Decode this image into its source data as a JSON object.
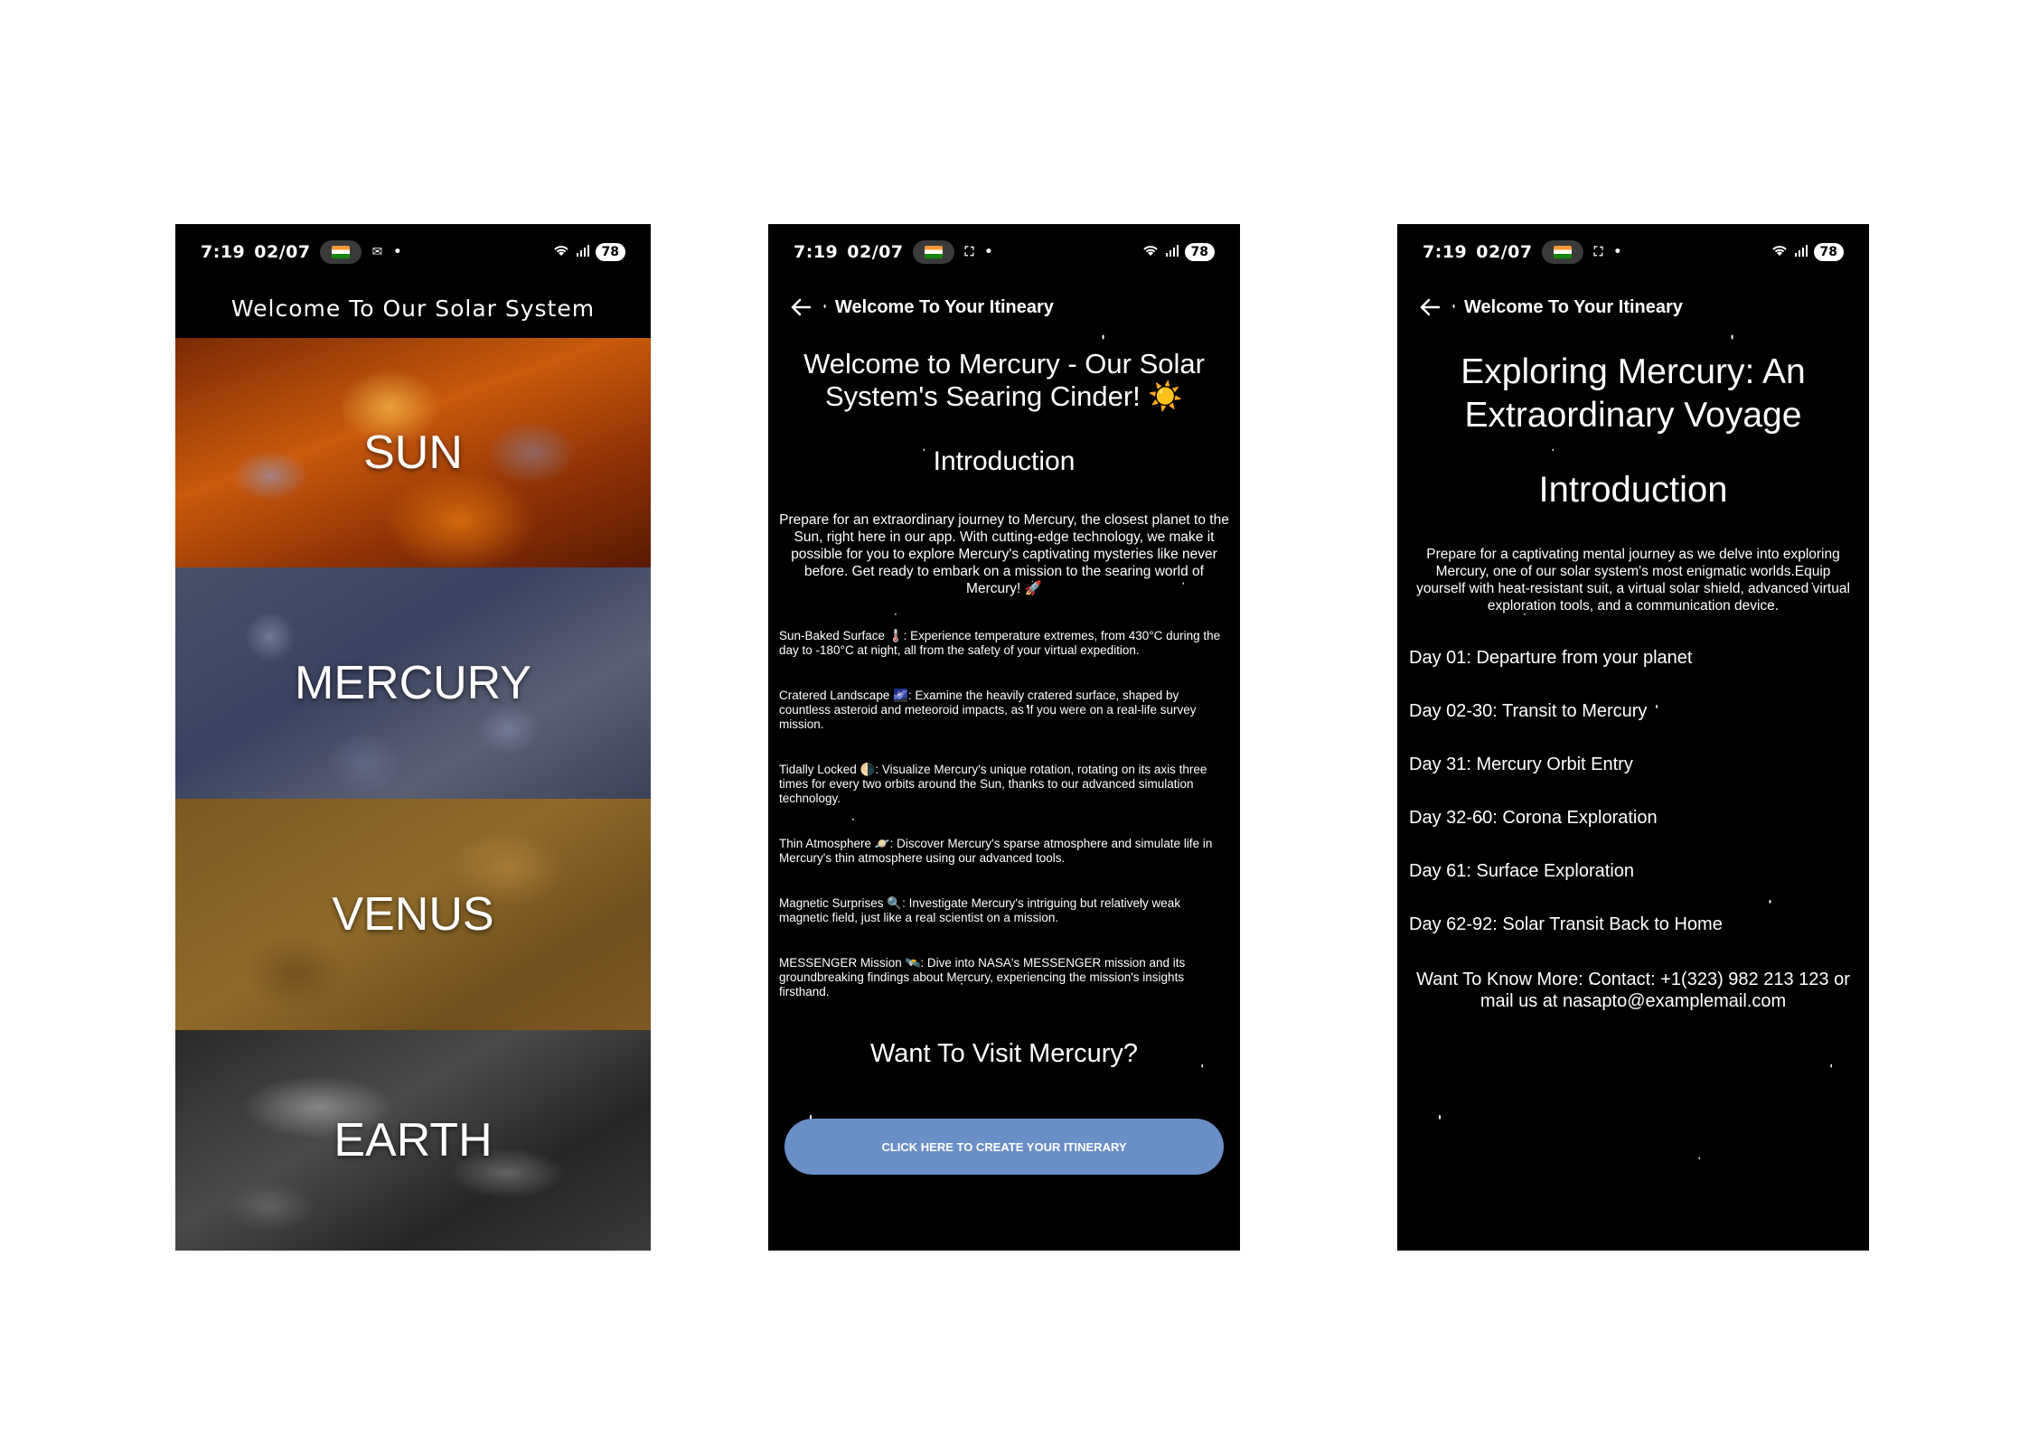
{
  "status_bar": {
    "time": "7:19",
    "date": "02/07",
    "battery": "78"
  },
  "screen1": {
    "title": "Welcome To Our Solar System",
    "planets": [
      "SUN",
      "MERCURY",
      "VENUS",
      "EARTH"
    ]
  },
  "screen2": {
    "appbar_title": "Welcome To Your Itineary",
    "heading": "Welcome to Mercury - Our Solar System's Searing Cinder! ☀️",
    "intro_heading": "Introduction",
    "intro_text": "Prepare for an extraordinary journey to Mercury, the closest planet to the Sun, right here in our app. With cutting-edge technology, we make it possible for you to explore Mercury's captivating mysteries like never before. Get ready to embark on a mission to the searing world of Mercury! 🚀",
    "features": [
      "Sun-Baked Surface 🌡️: Experience temperature extremes, from 430°C during the day to -180°C at night, all from the safety of your virtual expedition.",
      "Cratered Landscape 🌌: Examine the heavily cratered surface, shaped by countless asteroid and meteoroid impacts, as if you were on a real-life survey mission.",
      "Tidally Locked 🌗: Visualize Mercury's unique rotation, rotating on its axis three times for every two orbits around the Sun, thanks to our advanced simulation technology.",
      "Thin Atmosphere 🪐: Discover Mercury's sparse atmosphere and simulate life in Mercury's thin atmosphere using our advanced tools.",
      "Magnetic Surprises 🔍: Investigate Mercury's intriguing but relatively weak magnetic field, just like a real scientist on a mission.",
      "MESSENGER Mission 🛰️: Dive into NASA's MESSENGER mission and its groundbreaking findings about Mercury, experiencing the mission's insights firsthand."
    ],
    "visit_heading": "Want To Visit Mercury?",
    "cta_label": "CLICK HERE TO CREATE YOUR ITINERARY"
  },
  "screen3": {
    "appbar_title": "Welcome To Your Itineary",
    "heading": "Exploring Mercury: An Extraordinary Voyage",
    "intro_heading": "Introduction",
    "intro_text": "Prepare for a captivating mental journey as we delve into exploring Mercury, one of our solar system's most enigmatic worlds.Equip yourself with heat-resistant suit, a virtual solar shield, advanced virtual exploration tools, and a communication device.",
    "days": [
      "Day 01: Departure from your planet",
      "Day 02-30: Transit to Mercury",
      "Day 31: Mercury Orbit Entry",
      "Day 32-60: Corona Exploration",
      "Day 61: Surface Exploration",
      "Day 62-92: Solar Transit Back to Home"
    ],
    "contact": "Want To Know More: Contact: +1(323) 982 213 123 or mail us at nasapto@examplemail.com"
  }
}
